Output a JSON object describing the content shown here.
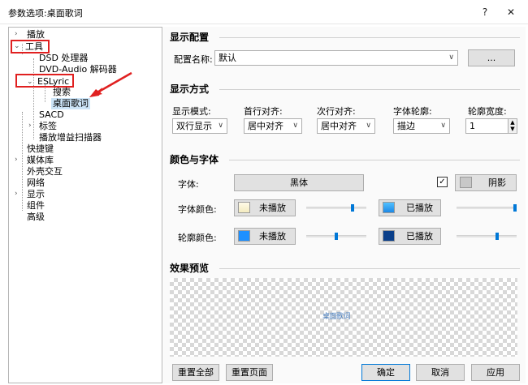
{
  "window": {
    "title": "参数选项:桌面歌词",
    "help_glyph": "?",
    "close_glyph": "✕"
  },
  "tree": {
    "items": [
      {
        "label": "播放"
      },
      {
        "label": "工具"
      },
      {
        "label": "DSD 处理器"
      },
      {
        "label": "DVD-Audio 解码器"
      },
      {
        "label": "ESLyric"
      },
      {
        "label": "搜索"
      },
      {
        "label": "桌面歌词"
      },
      {
        "label": "SACD"
      },
      {
        "label": "标签"
      },
      {
        "label": "播放增益扫描器"
      },
      {
        "label": "快捷键"
      },
      {
        "label": "媒体库"
      },
      {
        "label": "外壳交互"
      },
      {
        "label": "网络"
      },
      {
        "label": "显示"
      },
      {
        "label": "组件"
      },
      {
        "label": "高级"
      }
    ],
    "selected": "桌面歌词"
  },
  "display_config": {
    "title": "显示配置",
    "config_name_label": "配置名称:",
    "config_name_value": "默认",
    "more_button": "..."
  },
  "display_mode": {
    "title": "显示方式",
    "mode_label": "显示模式:",
    "mode_value": "双行显示",
    "first_align_label": "首行对齐:",
    "first_align_value": "居中对齐",
    "second_align_label": "次行对齐:",
    "second_align_value": "居中对齐",
    "outline_label": "字体轮廓:",
    "outline_value": "描边",
    "outline_width_label": "轮廓宽度:",
    "outline_width_value": "1"
  },
  "color_font": {
    "title": "颜色与字体",
    "font_label": "字体:",
    "font_value": "黑体",
    "shadow_checked": true,
    "shadow_label": "阴影",
    "font_color_label": "字体颜色:",
    "outline_color_label": "轮廓颜色:",
    "unplayed_label": "未播放",
    "played_label": "已播放",
    "colors": {
      "font_unplayed": "#fff8d6",
      "font_played": "#3aa0ff",
      "outline_unplayed": "#1e90ff",
      "outline_played": "#0a3f8a",
      "shadow": "#c8c8c8",
      "slider_thumb": "#0078d7"
    },
    "sliders": {
      "font_unplayed_alpha": 0.9,
      "font_played_alpha": 1.0,
      "outline_unplayed_alpha": 0.5,
      "outline_played_alpha": 0.65
    }
  },
  "preview": {
    "title": "效果预览",
    "sample_text": "桌面歌词"
  },
  "footer": {
    "reset_all": "重置全部",
    "reset_page": "重置页面",
    "ok": "确定",
    "cancel": "取消",
    "apply": "应用"
  }
}
